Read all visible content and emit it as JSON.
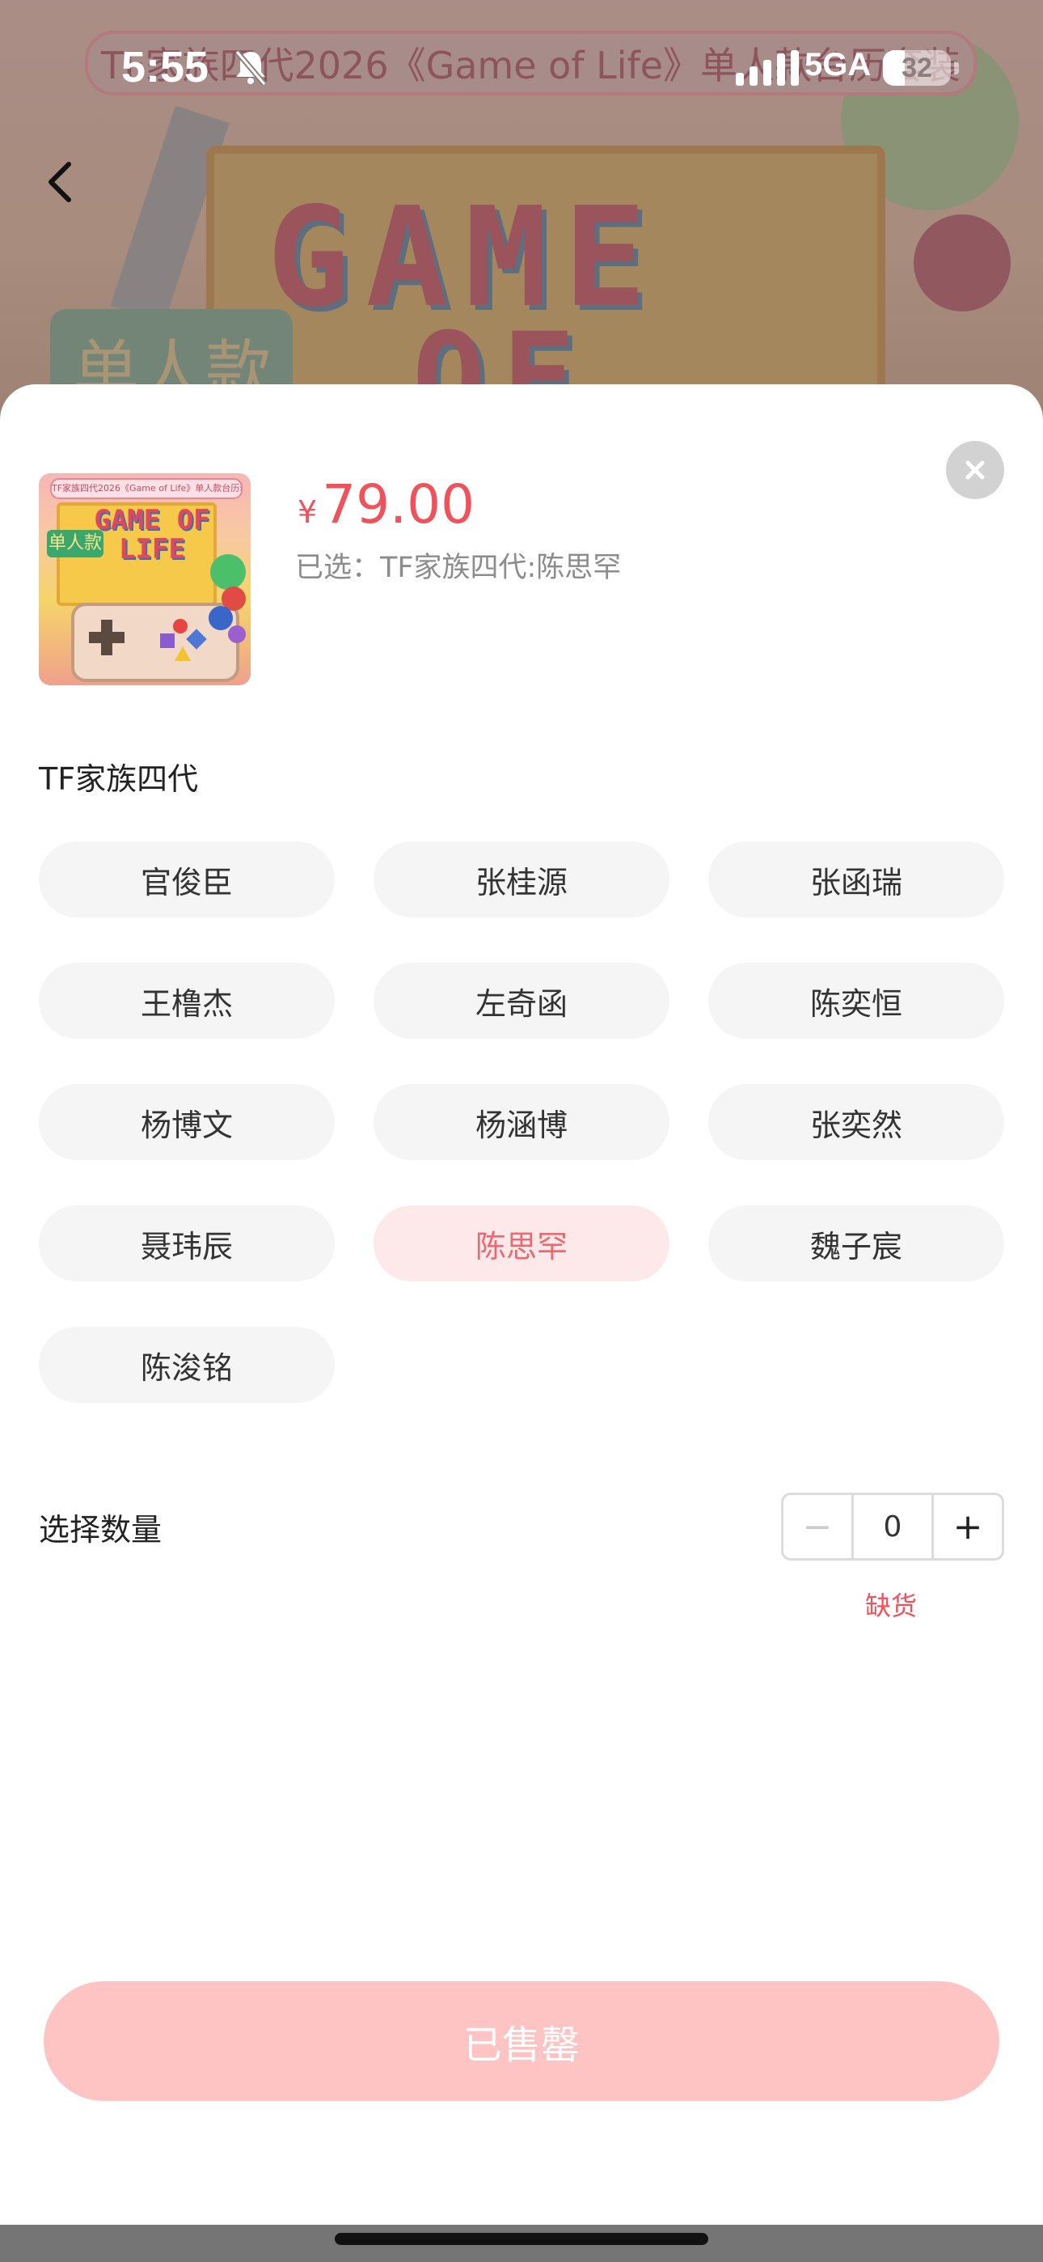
{
  "banner": {
    "title": "TF家族四代2026《Game of Life》单人款台历套装",
    "word_line1": "GAME",
    "word_line2": "OF",
    "tag": "单人款"
  },
  "status_bar": {
    "time": "5:55",
    "network": "5GA",
    "battery_level": "32",
    "battery_fraction": 0.32
  },
  "product": {
    "thumbnail": {
      "title": "TF家族四代2026《Game of Life》单人款台历套装",
      "word": "GAME OF LIFE",
      "tag": "单人款"
    },
    "price_symbol": "¥",
    "price": "79.00",
    "selected_text": "已选：TF家族四代:陈思罕"
  },
  "spec_group": {
    "title": "TF家族四代",
    "options": [
      {
        "label": "官俊臣"
      },
      {
        "label": "张桂源"
      },
      {
        "label": "张函瑞"
      },
      {
        "label": "王橹杰"
      },
      {
        "label": "左奇函"
      },
      {
        "label": "陈奕恒"
      },
      {
        "label": "杨博文"
      },
      {
        "label": "杨涵博"
      },
      {
        "label": "张奕然"
      },
      {
        "label": "聂玮辰"
      },
      {
        "label": "陈思罕",
        "selected": true
      },
      {
        "label": "魏子宸"
      },
      {
        "label": "陈浚铭"
      }
    ]
  },
  "quantity": {
    "label": "选择数量",
    "minus": "−",
    "value": "0",
    "plus": "+",
    "stock_status": "缺货"
  },
  "buy_button": {
    "label": "已售罄"
  },
  "colors": {
    "accent": "#f0525c",
    "selected_bg": "#fde9ea",
    "sold_out_button": "#fec4c4"
  }
}
